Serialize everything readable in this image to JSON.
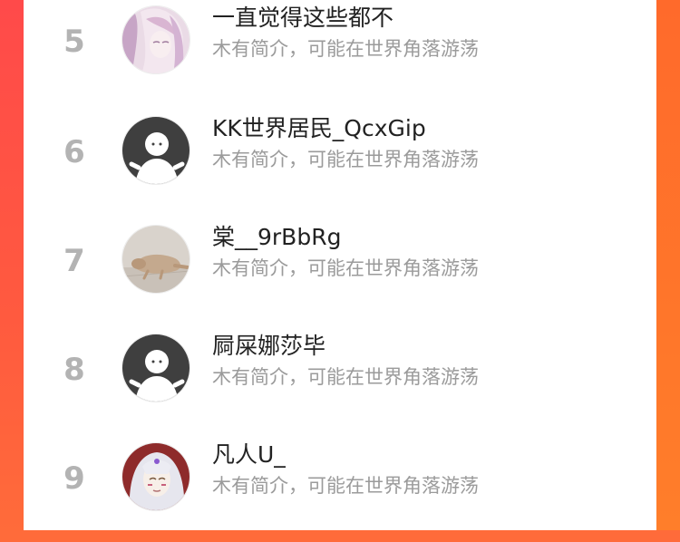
{
  "ranking": {
    "items": [
      {
        "rank": "5",
        "name": "一直觉得这些都不",
        "bio": "木有简介，可能在世界角落游荡",
        "avatar": "anime-portrait-pink"
      },
      {
        "rank": "6",
        "name": "KK世界居民_QcxGip",
        "bio": "木有简介，可能在世界角落游荡",
        "avatar": "default-avatar"
      },
      {
        "rank": "7",
        "name": "棠__9rBbRg",
        "bio": "木有简介，可能在世界角落游荡",
        "avatar": "cat-photo"
      },
      {
        "rank": "8",
        "name": "屙屎娜莎毕",
        "bio": "木有简介，可能在世界角落游荡",
        "avatar": "default-avatar"
      },
      {
        "rank": "9",
        "name": "凡人U_",
        "bio": "木有简介，可能在世界角落游荡",
        "avatar": "anime-portrait-white-hair"
      }
    ]
  },
  "colors": {
    "rank": "#b3b3b3",
    "name": "#222222",
    "bio": "#9b9b9b",
    "accent_left": "#ff4a4a",
    "accent_right": "#ff7e2a"
  }
}
